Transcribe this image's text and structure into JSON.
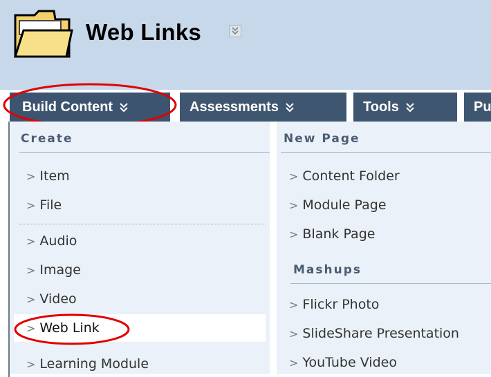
{
  "header": {
    "title": "Web Links",
    "folder_icon": "folder-icon",
    "title_menu_icon": "double-chevron-down-icon"
  },
  "tabs": [
    {
      "label": "Build Content",
      "icon": "double-chevron-down-icon"
    },
    {
      "label": "Assessments",
      "icon": "double-chevron-down-icon"
    },
    {
      "label": "Tools",
      "icon": "double-chevron-down-icon"
    },
    {
      "label": "Pu"
    }
  ],
  "menu": {
    "create_heading": "Create",
    "new_page_heading": "New Page",
    "mashups_heading": "Mashups",
    "create_items_a": [
      "Item",
      "File"
    ],
    "create_items_b": [
      "Audio",
      "Image",
      "Video",
      "Web Link",
      "Learning Module"
    ],
    "new_page_items": [
      "Content Folder",
      "Module Page",
      "Blank Page"
    ],
    "mashup_items": [
      "Flickr Photo",
      "SlideShare Presentation",
      "YouTube Video"
    ],
    "highlighted_item": "Web Link",
    "arrow_glyph": ">"
  },
  "colors": {
    "header_bg": "#c7d8ea",
    "tab_bg": "#3f5670",
    "menu_bg": "#ebf1f8",
    "heading_text": "#4a5d74",
    "annotation_red": "#e00000"
  }
}
